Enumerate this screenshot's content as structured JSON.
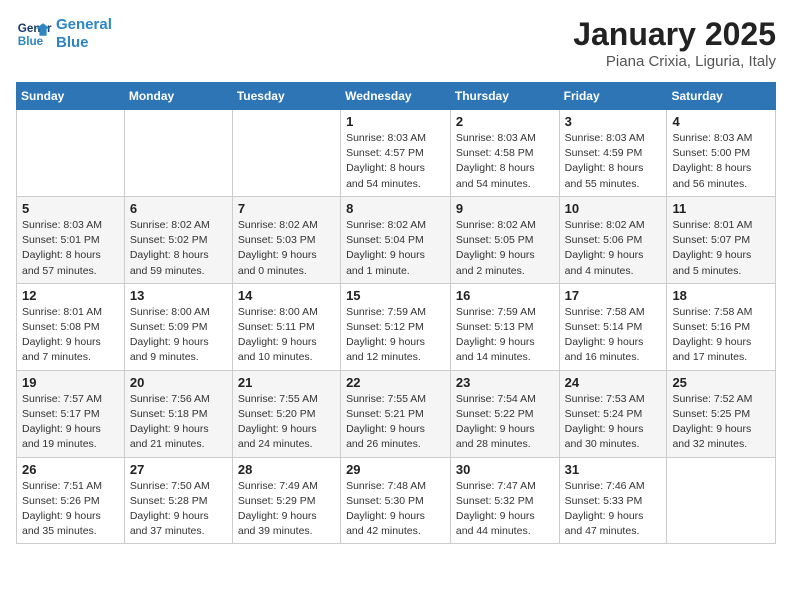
{
  "header": {
    "logo_line1": "General",
    "logo_line2": "Blue",
    "month": "January 2025",
    "location": "Piana Crixia, Liguria, Italy"
  },
  "weekdays": [
    "Sunday",
    "Monday",
    "Tuesday",
    "Wednesday",
    "Thursday",
    "Friday",
    "Saturday"
  ],
  "weeks": [
    [
      {
        "day": "",
        "info": ""
      },
      {
        "day": "",
        "info": ""
      },
      {
        "day": "",
        "info": ""
      },
      {
        "day": "1",
        "info": "Sunrise: 8:03 AM\nSunset: 4:57 PM\nDaylight: 8 hours\nand 54 minutes."
      },
      {
        "day": "2",
        "info": "Sunrise: 8:03 AM\nSunset: 4:58 PM\nDaylight: 8 hours\nand 54 minutes."
      },
      {
        "day": "3",
        "info": "Sunrise: 8:03 AM\nSunset: 4:59 PM\nDaylight: 8 hours\nand 55 minutes."
      },
      {
        "day": "4",
        "info": "Sunrise: 8:03 AM\nSunset: 5:00 PM\nDaylight: 8 hours\nand 56 minutes."
      }
    ],
    [
      {
        "day": "5",
        "info": "Sunrise: 8:03 AM\nSunset: 5:01 PM\nDaylight: 8 hours\nand 57 minutes."
      },
      {
        "day": "6",
        "info": "Sunrise: 8:02 AM\nSunset: 5:02 PM\nDaylight: 8 hours\nand 59 minutes."
      },
      {
        "day": "7",
        "info": "Sunrise: 8:02 AM\nSunset: 5:03 PM\nDaylight: 9 hours\nand 0 minutes."
      },
      {
        "day": "8",
        "info": "Sunrise: 8:02 AM\nSunset: 5:04 PM\nDaylight: 9 hours\nand 1 minute."
      },
      {
        "day": "9",
        "info": "Sunrise: 8:02 AM\nSunset: 5:05 PM\nDaylight: 9 hours\nand 2 minutes."
      },
      {
        "day": "10",
        "info": "Sunrise: 8:02 AM\nSunset: 5:06 PM\nDaylight: 9 hours\nand 4 minutes."
      },
      {
        "day": "11",
        "info": "Sunrise: 8:01 AM\nSunset: 5:07 PM\nDaylight: 9 hours\nand 5 minutes."
      }
    ],
    [
      {
        "day": "12",
        "info": "Sunrise: 8:01 AM\nSunset: 5:08 PM\nDaylight: 9 hours\nand 7 minutes."
      },
      {
        "day": "13",
        "info": "Sunrise: 8:00 AM\nSunset: 5:09 PM\nDaylight: 9 hours\nand 9 minutes."
      },
      {
        "day": "14",
        "info": "Sunrise: 8:00 AM\nSunset: 5:11 PM\nDaylight: 9 hours\nand 10 minutes."
      },
      {
        "day": "15",
        "info": "Sunrise: 7:59 AM\nSunset: 5:12 PM\nDaylight: 9 hours\nand 12 minutes."
      },
      {
        "day": "16",
        "info": "Sunrise: 7:59 AM\nSunset: 5:13 PM\nDaylight: 9 hours\nand 14 minutes."
      },
      {
        "day": "17",
        "info": "Sunrise: 7:58 AM\nSunset: 5:14 PM\nDaylight: 9 hours\nand 16 minutes."
      },
      {
        "day": "18",
        "info": "Sunrise: 7:58 AM\nSunset: 5:16 PM\nDaylight: 9 hours\nand 17 minutes."
      }
    ],
    [
      {
        "day": "19",
        "info": "Sunrise: 7:57 AM\nSunset: 5:17 PM\nDaylight: 9 hours\nand 19 minutes."
      },
      {
        "day": "20",
        "info": "Sunrise: 7:56 AM\nSunset: 5:18 PM\nDaylight: 9 hours\nand 21 minutes."
      },
      {
        "day": "21",
        "info": "Sunrise: 7:55 AM\nSunset: 5:20 PM\nDaylight: 9 hours\nand 24 minutes."
      },
      {
        "day": "22",
        "info": "Sunrise: 7:55 AM\nSunset: 5:21 PM\nDaylight: 9 hours\nand 26 minutes."
      },
      {
        "day": "23",
        "info": "Sunrise: 7:54 AM\nSunset: 5:22 PM\nDaylight: 9 hours\nand 28 minutes."
      },
      {
        "day": "24",
        "info": "Sunrise: 7:53 AM\nSunset: 5:24 PM\nDaylight: 9 hours\nand 30 minutes."
      },
      {
        "day": "25",
        "info": "Sunrise: 7:52 AM\nSunset: 5:25 PM\nDaylight: 9 hours\nand 32 minutes."
      }
    ],
    [
      {
        "day": "26",
        "info": "Sunrise: 7:51 AM\nSunset: 5:26 PM\nDaylight: 9 hours\nand 35 minutes."
      },
      {
        "day": "27",
        "info": "Sunrise: 7:50 AM\nSunset: 5:28 PM\nDaylight: 9 hours\nand 37 minutes."
      },
      {
        "day": "28",
        "info": "Sunrise: 7:49 AM\nSunset: 5:29 PM\nDaylight: 9 hours\nand 39 minutes."
      },
      {
        "day": "29",
        "info": "Sunrise: 7:48 AM\nSunset: 5:30 PM\nDaylight: 9 hours\nand 42 minutes."
      },
      {
        "day": "30",
        "info": "Sunrise: 7:47 AM\nSunset: 5:32 PM\nDaylight: 9 hours\nand 44 minutes."
      },
      {
        "day": "31",
        "info": "Sunrise: 7:46 AM\nSunset: 5:33 PM\nDaylight: 9 hours\nand 47 minutes."
      },
      {
        "day": "",
        "info": ""
      }
    ]
  ]
}
